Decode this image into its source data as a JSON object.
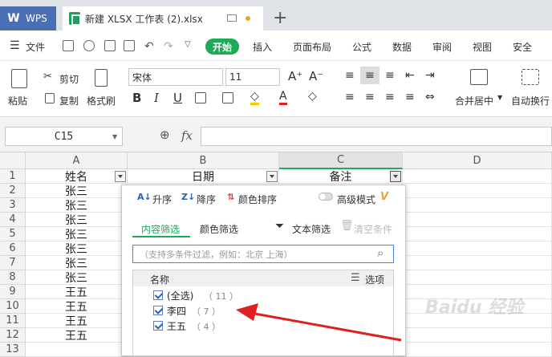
{
  "titlebar": {
    "app_tab": "WPS",
    "doc_tab": "新建 XLSX 工作表 (2).xlsx",
    "new_tab": "+"
  },
  "menu": {
    "file": "文件",
    "tabs": [
      "开始",
      "插入",
      "页面布局",
      "公式",
      "数据",
      "审阅",
      "视图",
      "安全"
    ]
  },
  "ribbon": {
    "paste": "粘贴",
    "cut": "剪切",
    "copy": "复制",
    "format_painter": "格式刷",
    "font_name": "宋体",
    "font_size": "11",
    "merge_center": "合并居中",
    "wrap_text": "自动换行"
  },
  "formula_bar": {
    "name_box": "C15",
    "fx": "fx",
    "formula": ""
  },
  "sheet": {
    "columns": [
      "A",
      "B",
      "C",
      "D"
    ],
    "header_row": [
      "姓名",
      "日期",
      "备注"
    ],
    "rows": [
      "1",
      "2",
      "3",
      "4",
      "5",
      "6",
      "7",
      "8",
      "9",
      "10",
      "11",
      "12",
      "13"
    ],
    "names": [
      "张三",
      "张三",
      "张三",
      "张三",
      "张三",
      "张三",
      "张三",
      "王五",
      "王五",
      "王五",
      "王五"
    ]
  },
  "filter_panel": {
    "sort_asc": "升序",
    "sort_desc": "降序",
    "sort_color": "颜色排序",
    "advanced_mode": "高级模式",
    "tab_content": "内容筛选",
    "tab_color": "颜色筛选",
    "text_filter": "文本筛选",
    "clear_filter": "清空条件",
    "search_placeholder": "（支持多条件过滤，例如：北京  上海）",
    "list_header": "名称",
    "options_label": "选项",
    "items": [
      {
        "label": "(全选)",
        "count": "（ 11 ）"
      },
      {
        "label": "李四",
        "count": "（ 7 ）"
      },
      {
        "label": "王五",
        "count": "（ 4 ）"
      }
    ]
  },
  "colors": {
    "accent_green": "#1eaa58",
    "annotation_red": "#e02020",
    "wps_blue": "#4a6fb5"
  }
}
